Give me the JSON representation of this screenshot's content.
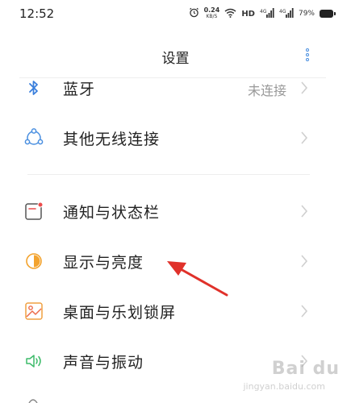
{
  "status_bar": {
    "time": "12:52",
    "net_speed_value": "0.24",
    "net_speed_unit": "KB/S",
    "hd_label": "HD",
    "signal_1_label": "4G",
    "signal_2_label": "4G",
    "battery_percent": "79%"
  },
  "header": {
    "title": "设置"
  },
  "settings": {
    "items": [
      {
        "label": "蓝牙",
        "status": "未连接",
        "icon": "bluetooth-icon"
      },
      {
        "label": "其他无线连接",
        "icon": "wireless-connections-icon"
      },
      {
        "label": "通知与状态栏",
        "icon": "notification-icon"
      },
      {
        "label": "显示与亮度",
        "icon": "display-brightness-icon"
      },
      {
        "label": "桌面与乐划锁屏",
        "icon": "desktop-lockscreen-icon"
      },
      {
        "label": "声音与振动",
        "icon": "sound-vibration-icon"
      }
    ]
  },
  "watermark": {
    "text": "Bai du",
    "sub": "jingyan.baidu.com"
  },
  "colors": {
    "accent_blue": "#4a8fe0",
    "bluetooth_blue": "#3a7fdc",
    "notification_red": "#ec4b4b",
    "display_orange": "#f3a32e",
    "desktop_orange": "#f0a040",
    "sound_green": "#3dbb6a",
    "arrow_red": "#e0312a"
  }
}
